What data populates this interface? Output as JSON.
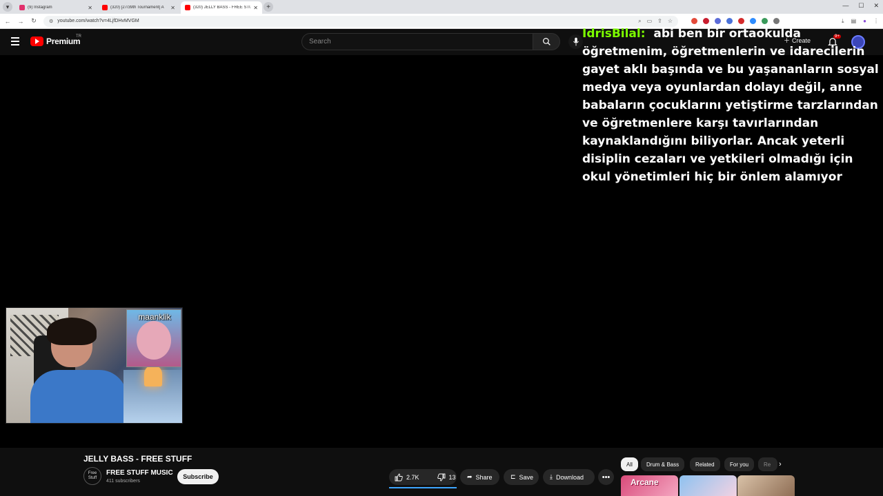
{
  "browser": {
    "tabs": [
      {
        "title": "(9) Instagram",
        "color": "#e1306c",
        "active": false
      },
      {
        "title": "(320) [27/39th Tournament] A",
        "color": "#ff0000",
        "active": false
      },
      {
        "title": "(320) JELLY BASS - FREE STUFF",
        "color": "#ff0000",
        "active": true
      }
    ],
    "url": "youtube.com/watch?v=4LjfDHvMVGM"
  },
  "youtube": {
    "logo_text": "Premium",
    "region": "TR",
    "search_placeholder": "Search",
    "create_label": "Create",
    "notification_count": "9+"
  },
  "overlay": {
    "username": "IdrisBilal:",
    "message": "abi ben bir ortaokulda öğretmenim, öğretmenlerin ve idarecilerin gayet aklı başında ve bu yaşananların sosyal medya veya oyunlardan dolayı değil, anne babaların çocuklarını yetiştirme tarzlarından ve öğretmenlere karşı tavırlarından kaynaklandığını biliyorlar. Ancak yeterli disiplin cezaları ve yetkileri olmadığı için okul yönetimleri hiç bir önlem alamıyor"
  },
  "webcam": {
    "inset_name": "maanklik"
  },
  "video": {
    "title": "JELLY BASS - FREE STUFF",
    "channel_name": "FREE STUFF MUSIC",
    "channel_avatar_text": "Free Stuff",
    "subscribers": "411 subscribers",
    "subscribe_label": "Subscribe",
    "likes": "2.7K",
    "dislikes": "13",
    "share_label": "Share",
    "save_label": "Save",
    "download_label": "Download"
  },
  "chips": [
    "All",
    "Drum & Bass",
    "Related",
    "For you",
    "Re"
  ],
  "thumbnails": [
    {
      "text": "Arcane"
    },
    {
      "text": ""
    },
    {
      "text": ""
    }
  ]
}
